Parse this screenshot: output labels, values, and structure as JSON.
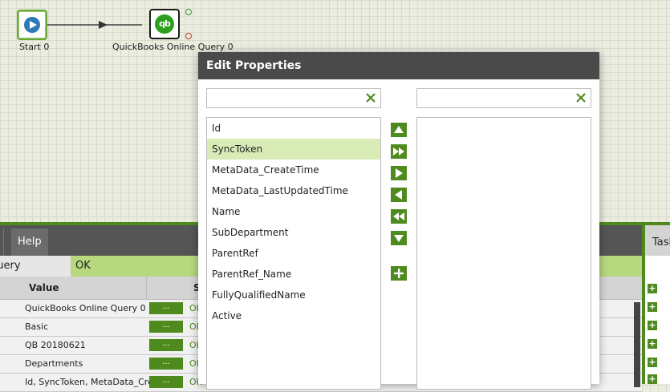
{
  "canvas": {
    "nodes": [
      {
        "label": "Start 0",
        "icon": "play-icon"
      },
      {
        "label": "QuickBooks Online Query 0",
        "icon_text": "qb",
        "icon": "quickbooks-icon"
      }
    ]
  },
  "bottom_panel": {
    "tabs": [
      {
        "label": "c"
      },
      {
        "label": "Help"
      }
    ],
    "status": {
      "name": "Query",
      "value": "OK"
    },
    "table": {
      "headers": {
        "value": "Value",
        "status": "S"
      },
      "button_label": "...",
      "status_text": "OK",
      "rows": [
        {
          "value": "QuickBooks Online Query 0"
        },
        {
          "value": "Basic"
        },
        {
          "value": "QB 20180621"
        },
        {
          "value": "Departments"
        },
        {
          "value": "Id, SyncToken, MetaData_Cre..."
        }
      ]
    }
  },
  "right_panel": {
    "tab_label": "Task",
    "plus_label": "+"
  },
  "dialog": {
    "title": "Edit Properties",
    "left_filter": {
      "value": "",
      "placeholder": ""
    },
    "right_filter": {
      "value": "",
      "placeholder": ""
    },
    "available_fields": [
      "Id",
      "SyncToken",
      "MetaData_CreateTime",
      "MetaData_LastUpdatedTime",
      "Name",
      "SubDepartment",
      "ParentRef",
      "ParentRef_Name",
      "FullyQualifiedName",
      "Active"
    ],
    "selected_index": 1,
    "selected_fields": [],
    "colors": {
      "accent": "#4f8a1e",
      "selected_row": "#d9ebb6",
      "title_bar": "#4a4a4a"
    }
  }
}
